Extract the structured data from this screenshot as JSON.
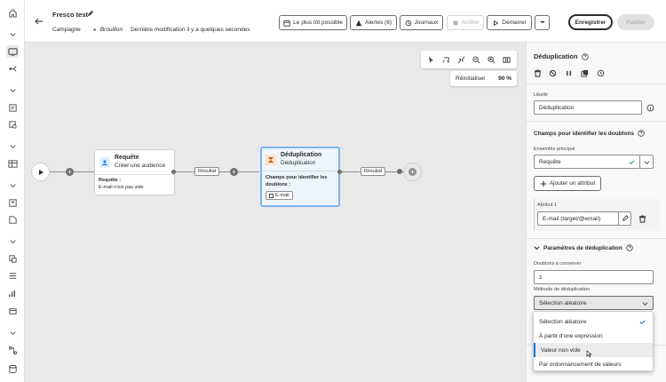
{
  "header": {
    "title": "Fresco test",
    "type_label": "Campagne",
    "status": "Brouillon",
    "last_modified": "Dernière modification il y a quelques secondes",
    "buttons": {
      "asap": "Le plus tôt possible",
      "alerts": "Alertes (6)",
      "logs": "Journaux",
      "stop": "Arrêter",
      "start": "Démarrer",
      "more": "•••",
      "save": "Enregistrer",
      "publish": "Publier"
    }
  },
  "canvas": {
    "reset_label": "Réinitialiser",
    "zoom": "90 %",
    "nodes": {
      "query": {
        "title": "Requête",
        "subtitle": "Créer une audience",
        "detail_label": "Requête :",
        "detail_value": "E-mail n'est pas vide"
      },
      "dedup": {
        "title": "Déduplication",
        "subtitle": "Déduplication",
        "detail_label": "Champs pour identifier les doublons :",
        "tag": "E-mail"
      }
    },
    "transition_label_1": "Résultat",
    "transition_label_2": "Résultat"
  },
  "panel": {
    "title": "Déduplication",
    "label_caption": "Libellé",
    "label_value": "Déduplication",
    "fields_section": "Champs pour identifier les doublons",
    "main_set_caption": "Ensemble principal",
    "main_set_value": "Requête",
    "add_attribute": "Ajouter un attribut",
    "attribute_caption": "Attribut 1",
    "attribute_value": "E-mail (target/@email)",
    "params_section": "Paramètres de déduplication",
    "duplicates_caption": "Doublons à conserver",
    "duplicates_value": "1",
    "method_caption": "Méthode de déduplication",
    "method_value": "Sélection aléatoire"
  },
  "dropdown": {
    "options": [
      "Sélection aléatoire",
      "À partir d'une expression",
      "Valeur non vide",
      "Par ordonnancement de valeurs"
    ],
    "selected_index": 0,
    "hover_index": 2
  },
  "colors": {
    "accent": "#1473e6",
    "success": "#2d9d78",
    "canvas_bg": "#e9e9e9"
  }
}
